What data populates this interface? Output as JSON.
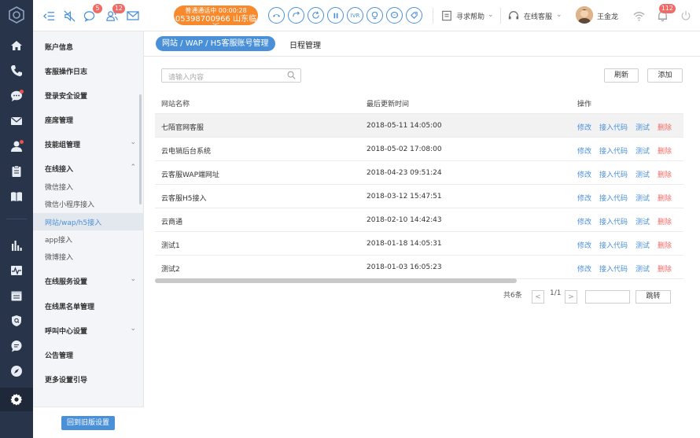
{
  "rail": {
    "icons": [
      "logo-icon",
      "home-icon",
      "phone-icon",
      "chat-icon",
      "mail-icon",
      "user-icon",
      "clipboard-icon",
      "book-icon",
      "bar-chart-icon",
      "pulse-icon",
      "calendar-icon",
      "shield-icon",
      "message-icon",
      "compass-icon",
      "settings-icon"
    ]
  },
  "topbar": {
    "badge_chat": "5",
    "badge_group": "12",
    "call_status": "普通通话中  00:00:28",
    "call_number": "05398700966 山东临沂",
    "ivr_label": "IVR",
    "help_label": "寻求帮助",
    "online_label": "在线客服",
    "user_name": "王金龙",
    "badge_notice": "112"
  },
  "sidebar": {
    "items": [
      {
        "label": "账户信息"
      },
      {
        "label": "客服操作日志"
      },
      {
        "label": "登录安全设置"
      },
      {
        "label": "座席管理"
      },
      {
        "label": "技能组管理"
      },
      {
        "label": "在线接入"
      }
    ],
    "subitems": [
      {
        "label": "微信接入"
      },
      {
        "label": "微信小程序接入"
      },
      {
        "label": "网站/wap/h5接入"
      },
      {
        "label": "app接入"
      },
      {
        "label": "微博接入"
      }
    ],
    "items2": [
      {
        "label": "在线服务设置"
      },
      {
        "label": "在线黑名单管理"
      },
      {
        "label": "呼叫中心设置"
      },
      {
        "label": "公告管理"
      },
      {
        "label": "更多设置引导"
      }
    ],
    "back_button": "回到旧版设置"
  },
  "main": {
    "tab_active": "网站 / WAP / H5客服账号管理",
    "tab_other": "日程管理",
    "search_placeholder": "请输入内容",
    "refresh_label": "刷新",
    "add_label": "添加",
    "columns": [
      "网站名称",
      "最后更新时间",
      "操作"
    ],
    "rows": [
      {
        "name": "七陌官网客服",
        "time": "2018-05-11  14:05:00"
      },
      {
        "name": "云电销后台系统",
        "time": "2018-05-02  17:08:00"
      },
      {
        "name": "云客服WAP端网址",
        "time": " 2018-04-23  09:51:24"
      },
      {
        "name": "云客服H5接入",
        "time": "2018-03-12  15:47:51"
      },
      {
        "name": "云商通",
        "time": "2018-02-10  14:42:43"
      },
      {
        "name": "测试1",
        "time": "2018-01-18  14:05:31"
      },
      {
        "name": "测试2",
        "time": "2018-01-03  16:05:23"
      }
    ],
    "ops": {
      "edit": "修改",
      "code": "接入代码",
      "test": "测试",
      "delete": "删除"
    },
    "pager": {
      "total": "共6条",
      "prev": "<",
      "page": "1/1",
      "next": ">",
      "go": "跳转"
    }
  }
}
